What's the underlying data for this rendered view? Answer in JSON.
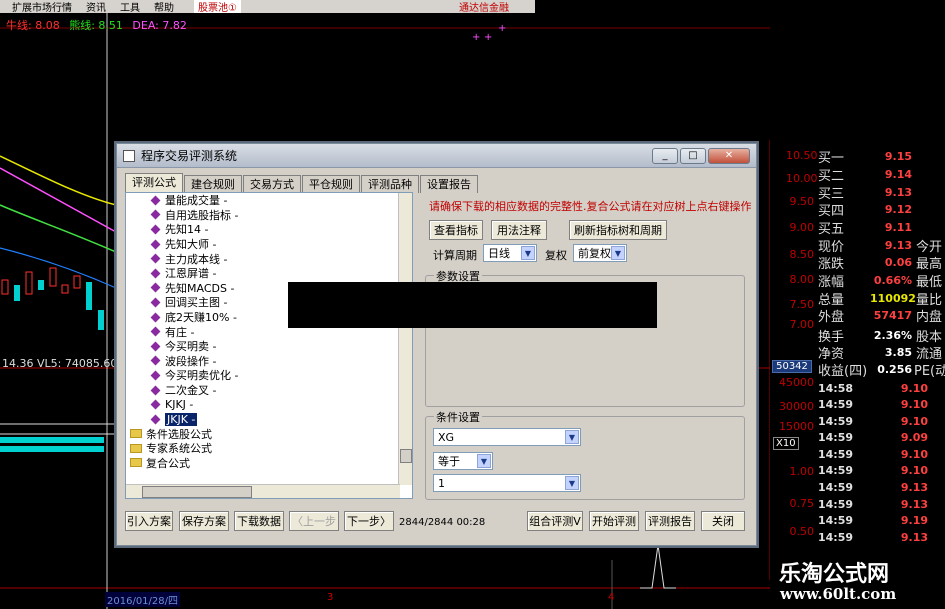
{
  "menu": {
    "items": [
      "扩展市场行情",
      "资讯",
      "工具",
      "帮助"
    ],
    "stock_pool": "股票池①",
    "broker": "通达信金融"
  },
  "indicators": {
    "line1": "牛线: 8.08",
    "line2": "熊线: 8.51",
    "dea": "DEA: 7.82"
  },
  "chart": {
    "vl_readout": "14.36  VL5: 74085.60",
    "date": "2016/01/28/四",
    "x_labels": [
      "3",
      "4"
    ],
    "x10": "X10",
    "box_value": "50342"
  },
  "right_panel": {
    "price_ticks": [
      "10.50",
      "10.00",
      "9.50",
      "9.00",
      "8.50",
      "8.00",
      "7.50",
      "7.00"
    ],
    "quotes": [
      {
        "label": "买一",
        "value": "9.15",
        "ext": ""
      },
      {
        "label": "买二",
        "value": "9.14",
        "ext": ""
      },
      {
        "label": "买三",
        "value": "9.13",
        "ext": ""
      },
      {
        "label": "买四",
        "value": "9.12",
        "ext": ""
      },
      {
        "label": "买五",
        "value": "9.11",
        "ext": ""
      },
      {
        "label": "现价",
        "value": "9.13",
        "ext": "今开"
      },
      {
        "label": "涨跌",
        "value": "0.06",
        "ext": "最高"
      },
      {
        "label": "涨幅",
        "value": "0.66%",
        "ext": "最低"
      },
      {
        "label": "总量",
        "value": "110092",
        "ext": "量比"
      },
      {
        "label": "外盘",
        "value": "57417",
        "ext": "内盘"
      },
      {
        "label": "换手",
        "value": "2.36%",
        "ext": "股本"
      },
      {
        "label": "净资",
        "value": "3.85",
        "ext": "流通"
      },
      {
        "label": "收益(四)",
        "value": "0.256",
        "ext": "PE(动)"
      }
    ],
    "vol_ticks": [
      "45000",
      "30000",
      "15000",
      "X10"
    ],
    "trades": [
      {
        "time": "14:58",
        "price": "9.10"
      },
      {
        "time": "14:59",
        "price": "9.10"
      },
      {
        "time": "14:59",
        "price": "9.10"
      },
      {
        "time": "14:59",
        "price": "9.09"
      },
      {
        "time": "14:59",
        "price": "9.10"
      },
      {
        "time": "14:59",
        "price": "9.10"
      },
      {
        "time": "14:59",
        "price": "9.13"
      },
      {
        "time": "14:59",
        "price": "9.13"
      },
      {
        "time": "14:59",
        "price": "9.19"
      },
      {
        "time": "14:59",
        "price": "9.13"
      }
    ],
    "price_ticks_low": [
      "1.00",
      "0.75",
      "0.50"
    ]
  },
  "watermark": {
    "name": "乐淘公式网",
    "url": "www.60lt.com"
  },
  "dialog": {
    "title": "程序交易评测系统",
    "tabs": [
      "评测公式",
      "建仓规则",
      "交易方式",
      "平仓规则",
      "评测品种",
      "设置报告"
    ],
    "tree_items": [
      {
        "label": "量能成交量 -",
        "type": "formula"
      },
      {
        "label": "自用选股指标 -",
        "type": "formula"
      },
      {
        "label": "先知14 -",
        "type": "formula"
      },
      {
        "label": "先知大师 -",
        "type": "formula"
      },
      {
        "label": "主力成本线 -",
        "type": "formula"
      },
      {
        "label": "江恩屏谱 -",
        "type": "formula"
      },
      {
        "label": "先知MACDS -",
        "type": "formula"
      },
      {
        "label": "回调买主图 -",
        "type": "formula"
      },
      {
        "label": "底2天赚10% -",
        "type": "formula"
      },
      {
        "label": "有庄 -",
        "type": "formula"
      },
      {
        "label": "今买明卖 -",
        "type": "formula"
      },
      {
        "label": "波段操作 -",
        "type": "formula"
      },
      {
        "label": "今买明卖优化 -",
        "type": "formula"
      },
      {
        "label": "二次金叉 -",
        "type": "formula"
      },
      {
        "label": "KJKJ -",
        "type": "formula"
      },
      {
        "label": "JKJK -",
        "type": "formula-selected"
      },
      {
        "label": "条件选股公式",
        "type": "folder"
      },
      {
        "label": "专家系统公式",
        "type": "folder"
      },
      {
        "label": "复合公式",
        "type": "folder"
      }
    ],
    "warning": "请确保下载的相应数据的完整性.复合公式请在对应树上点右键操作",
    "buttons": {
      "view_indicator": "查看指标",
      "usage_note": "用法注释",
      "refresh_tree": "刷新指标树和周期",
      "import": "引入方案",
      "save": "保存方案",
      "download": "下载数据",
      "prev": "〈上一步",
      "next": "下一步〉",
      "combo": "组合评测V",
      "start": "开始评测",
      "report": "评测报告",
      "close": "关闭"
    },
    "period_label": "计算周期",
    "period_value": "日线",
    "adjust_label": "复权",
    "adjust_value": "前复权",
    "param_group": "参数设置",
    "cond_group": "条件设置",
    "cond_field": "XG",
    "cond_op": "等于",
    "cond_value": "1",
    "status": "2844/2844  00:28"
  }
}
